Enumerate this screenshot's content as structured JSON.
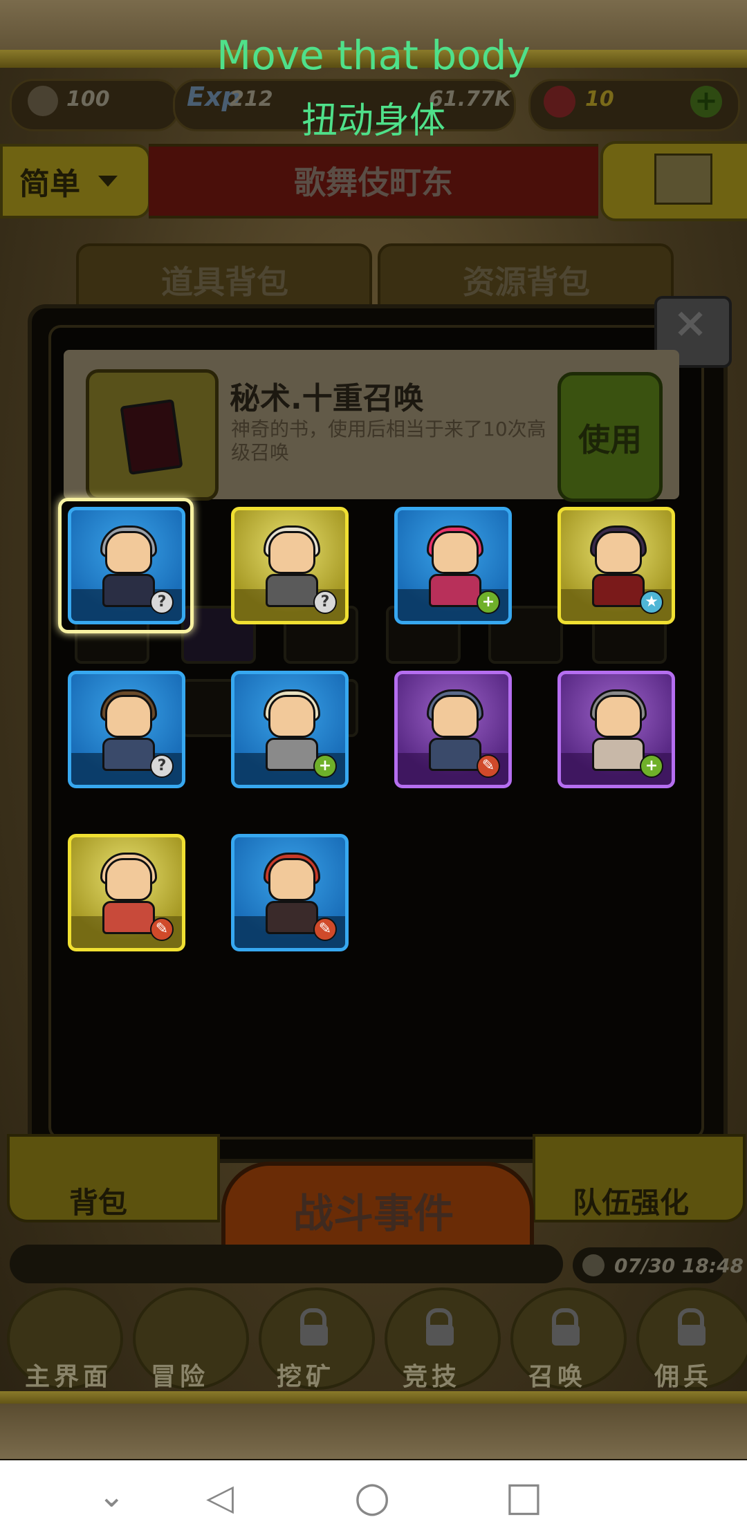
{
  "captions": {
    "english": "Move that body",
    "chinese": "扭动身体"
  },
  "resources": {
    "attack": "100",
    "exp_label": "Exp",
    "exp": "212",
    "gold": "61.77K",
    "gems": "10"
  },
  "difficulty": {
    "label": "简单"
  },
  "stage": {
    "title": "歌舞伎町东"
  },
  "tabs": [
    {
      "label": "道具背包"
    },
    {
      "label": "资源背包"
    }
  ],
  "selected_item": {
    "name": "秘术.十重召唤",
    "description": "神奇的书，使用后相当于来了10次高级召唤",
    "use_label": "使用"
  },
  "heroes": [
    {
      "rarity": "blue",
      "badge": "?",
      "badge_type": "q",
      "hair": "#9aa0a8",
      "body": "#2a2e44"
    },
    {
      "rarity": "gold",
      "badge": "?",
      "badge_type": "q",
      "hair": "#e6e0d0",
      "body": "#5a5a5a"
    },
    {
      "rarity": "blue",
      "badge": "+",
      "badge_type": "plus",
      "hair": "#e8336a",
      "body": "#b8305a"
    },
    {
      "rarity": "gold",
      "badge": "★",
      "badge_type": "star",
      "hair": "#3a2a4a",
      "body": "#7a1a1a"
    },
    {
      "rarity": "blue",
      "badge": "?",
      "badge_type": "q",
      "hair": "#6a4a2a",
      "body": "#3a4a6a"
    },
    {
      "rarity": "blue",
      "badge": "+",
      "badge_type": "plus",
      "hair": "#e8e0c0",
      "body": "#8a8a8a"
    },
    {
      "rarity": "purple",
      "badge": "✎",
      "badge_type": "ax",
      "hair": "#5a6a8a",
      "body": "#3a4a6a"
    },
    {
      "rarity": "purple",
      "badge": "+",
      "badge_type": "plus",
      "hair": "#8a8a8a",
      "body": "#c8b8a8"
    },
    {
      "rarity": "gold",
      "badge": "✎",
      "badge_type": "ax",
      "hair": "#f2c99a",
      "body": "#c84a3a"
    },
    {
      "rarity": "blue",
      "badge": "✎",
      "badge_type": "ax",
      "hair": "#c83a2a",
      "body": "#3a2a2a"
    }
  ],
  "bottom_buttons": {
    "backpack": "背包",
    "battle": "战斗事件",
    "team_upgrade": "队伍强化"
  },
  "clock": "07/30 18:48",
  "bottom_nav": [
    {
      "label": "主界面",
      "locked": false
    },
    {
      "label": "冒险",
      "locked": false
    },
    {
      "label": "挖矿",
      "locked": true
    },
    {
      "label": "竞技",
      "locked": true
    },
    {
      "label": "召唤",
      "locked": true
    },
    {
      "label": "佣兵",
      "locked": true
    }
  ],
  "system_nav": {
    "down": "⌄",
    "back": "◁",
    "home": "○",
    "recents": "□"
  }
}
